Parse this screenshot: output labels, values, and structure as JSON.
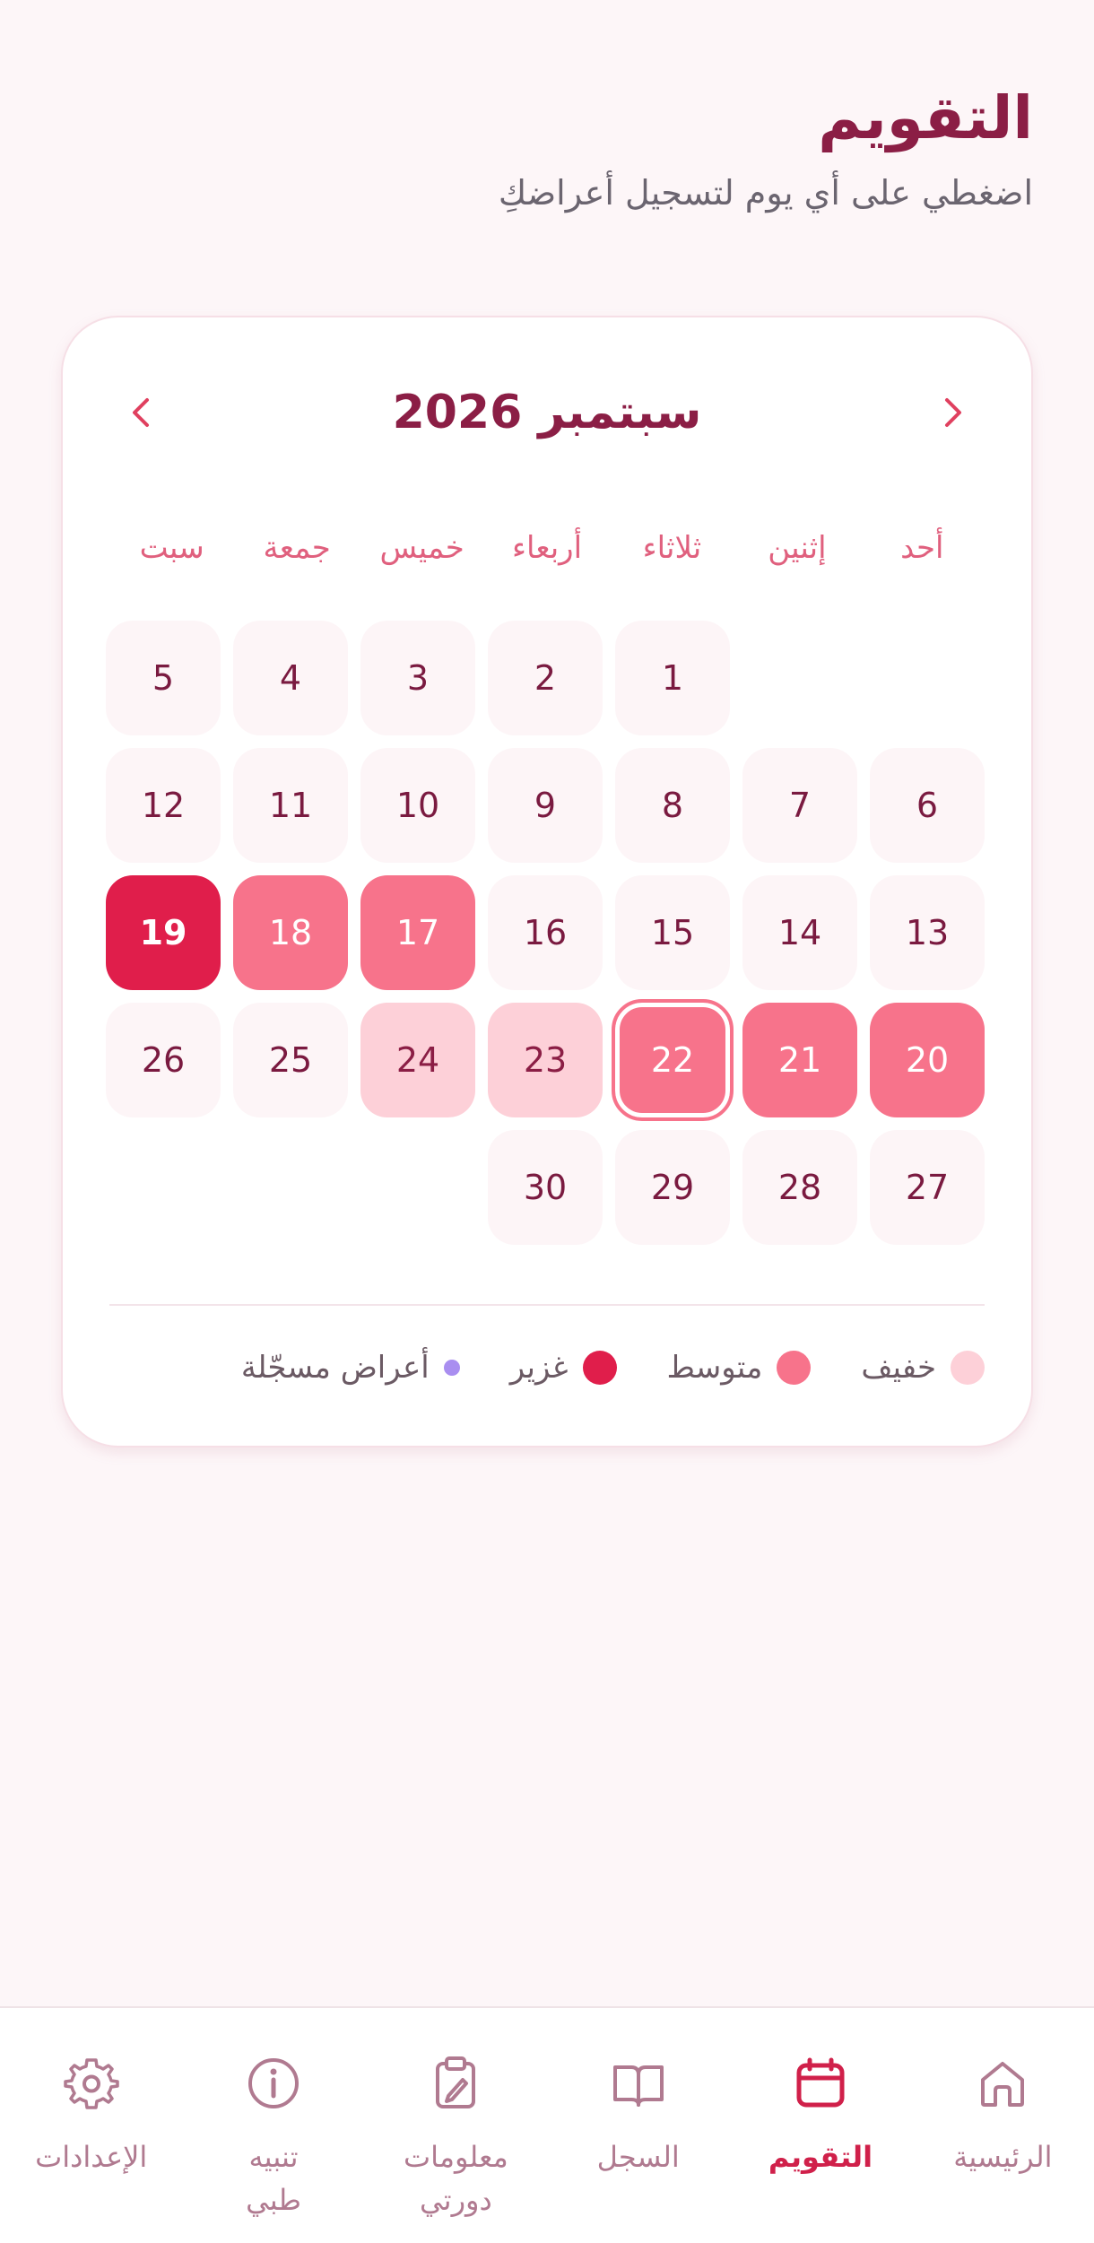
{
  "header": {
    "title": "التقويم",
    "subtitle": "اضغطي على أي يوم لتسجيل أعراضكِ"
  },
  "calendar": {
    "month_label": "سبتمبر 2026",
    "weekdays": [
      "أحد",
      "إثنين",
      "ثلاثاء",
      "أربعاء",
      "خميس",
      "جمعة",
      "سبت"
    ],
    "days": [
      {
        "label": "",
        "level": "empty"
      },
      {
        "label": "",
        "level": "empty"
      },
      {
        "label": "1",
        "level": "none"
      },
      {
        "label": "2",
        "level": "none"
      },
      {
        "label": "3",
        "level": "none"
      },
      {
        "label": "4",
        "level": "none"
      },
      {
        "label": "5",
        "level": "none"
      },
      {
        "label": "6",
        "level": "none"
      },
      {
        "label": "7",
        "level": "none"
      },
      {
        "label": "8",
        "level": "none"
      },
      {
        "label": "9",
        "level": "none"
      },
      {
        "label": "10",
        "level": "none"
      },
      {
        "label": "11",
        "level": "none"
      },
      {
        "label": "12",
        "level": "none"
      },
      {
        "label": "13",
        "level": "none"
      },
      {
        "label": "14",
        "level": "none"
      },
      {
        "label": "15",
        "level": "none"
      },
      {
        "label": "16",
        "level": "none"
      },
      {
        "label": "17",
        "level": "medium"
      },
      {
        "label": "18",
        "level": "medium"
      },
      {
        "label": "19",
        "level": "heavy"
      },
      {
        "label": "20",
        "level": "medium"
      },
      {
        "label": "21",
        "level": "medium"
      },
      {
        "label": "22",
        "level": "medium",
        "today": true
      },
      {
        "label": "23",
        "level": "light"
      },
      {
        "label": "24",
        "level": "light"
      },
      {
        "label": "25",
        "level": "none"
      },
      {
        "label": "26",
        "level": "none"
      },
      {
        "label": "27",
        "level": "none"
      },
      {
        "label": "28",
        "level": "none"
      },
      {
        "label": "29",
        "level": "none"
      },
      {
        "label": "30",
        "level": "none"
      },
      {
        "label": "",
        "level": "empty"
      },
      {
        "label": "",
        "level": "empty"
      },
      {
        "label": "",
        "level": "empty"
      }
    ]
  },
  "legend": [
    {
      "label": "خفيف",
      "color": "#fdd0d8",
      "dot": "large"
    },
    {
      "label": "متوسط",
      "color": "#f7738b",
      "dot": "large"
    },
    {
      "label": "غزير",
      "color": "#e01e4b",
      "dot": "large"
    },
    {
      "label": "أعراض مسجّلة",
      "color": "#a98ef0",
      "dot": "small"
    }
  ],
  "colors": {
    "accent": "#8b1e45",
    "active_nav": "#d0204a",
    "inactive_nav": "#b07a90"
  },
  "nav": [
    {
      "label": "الرئيسية",
      "icon": "home-icon",
      "active": false
    },
    {
      "label": "التقويم",
      "icon": "calendar-icon",
      "active": true
    },
    {
      "label": "السجل",
      "icon": "book-icon",
      "active": false
    },
    {
      "label": "معلومات دورتي",
      "icon": "clipboard-edit-icon",
      "active": false
    },
    {
      "label": "تنبيه طبي",
      "icon": "info-icon",
      "active": false
    },
    {
      "label": "الإعدادات",
      "icon": "gear-icon",
      "active": false
    }
  ]
}
